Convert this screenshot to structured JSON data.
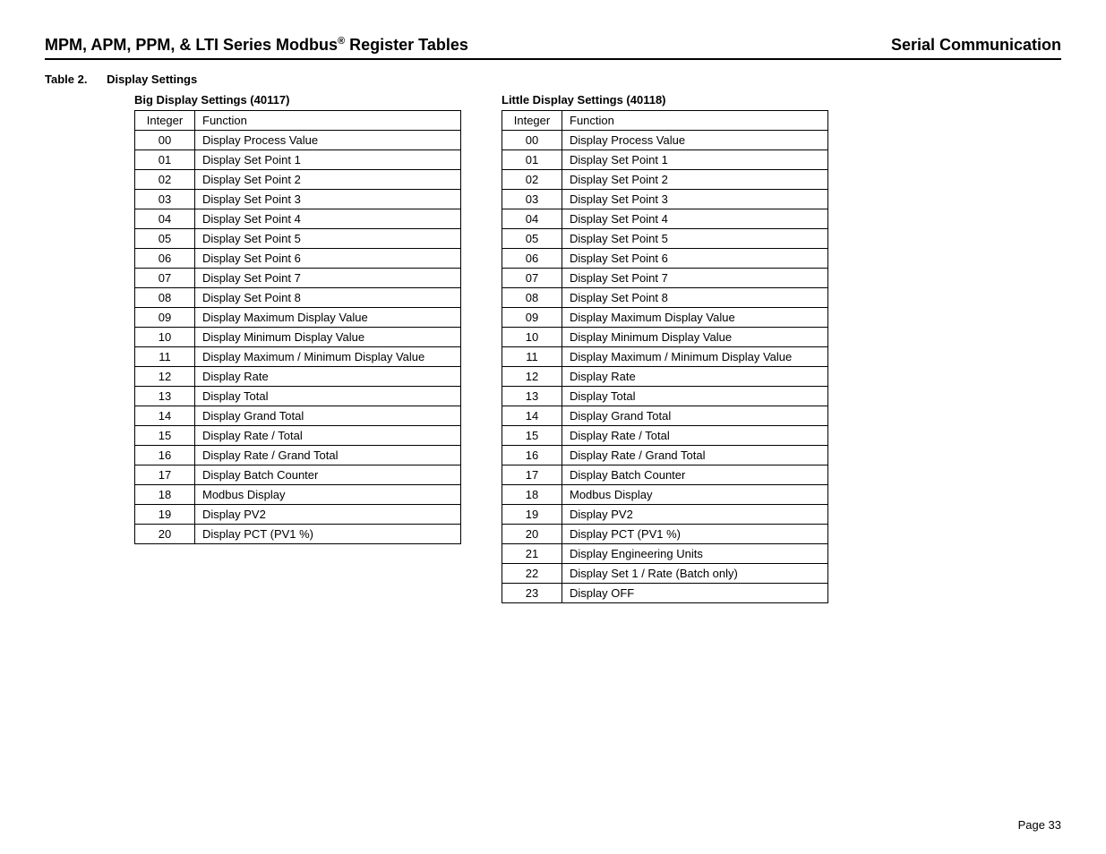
{
  "header": {
    "left_prefix": "MPM, APM, PPM, & LTI Series Modbus",
    "left_sup": "®",
    "left_suffix": " Register Tables",
    "right": "Serial Communication"
  },
  "caption": {
    "num": "Table 2.",
    "title": "Display Settings"
  },
  "tables": {
    "big": {
      "title": "Big Display Settings (40117)",
      "col1": "Integer",
      "col2": "Function",
      "rows": [
        {
          "int": "00",
          "func": "Display Process Value"
        },
        {
          "int": "01",
          "func": "Display Set Point 1"
        },
        {
          "int": "02",
          "func": "Display Set Point 2"
        },
        {
          "int": "03",
          "func": "Display Set Point 3"
        },
        {
          "int": "04",
          "func": "Display Set Point 4"
        },
        {
          "int": "05",
          "func": "Display Set Point 5"
        },
        {
          "int": "06",
          "func": "Display Set Point 6"
        },
        {
          "int": "07",
          "func": "Display Set Point 7"
        },
        {
          "int": "08",
          "func": "Display Set Point 8"
        },
        {
          "int": "09",
          "func": "Display Maximum Display Value"
        },
        {
          "int": "10",
          "func": "Display Minimum Display Value"
        },
        {
          "int": "11",
          "func": "Display Maximum / Minimum Display Value"
        },
        {
          "int": "12",
          "func": "Display Rate"
        },
        {
          "int": "13",
          "func": "Display Total"
        },
        {
          "int": "14",
          "func": "Display Grand Total"
        },
        {
          "int": "15",
          "func": "Display Rate / Total"
        },
        {
          "int": "16",
          "func": "Display Rate / Grand Total"
        },
        {
          "int": "17",
          "func": "Display Batch Counter"
        },
        {
          "int": "18",
          "func": "Modbus Display"
        },
        {
          "int": "19",
          "func": "Display PV2"
        },
        {
          "int": "20",
          "func": "Display PCT (PV1 %)"
        }
      ]
    },
    "little": {
      "title": "Little Display Settings (40118)",
      "col1": "Integer",
      "col2": "Function",
      "rows": [
        {
          "int": "00",
          "func": "Display Process Value"
        },
        {
          "int": "01",
          "func": "Display Set Point 1"
        },
        {
          "int": "02",
          "func": "Display Set Point 2"
        },
        {
          "int": "03",
          "func": "Display Set Point 3"
        },
        {
          "int": "04",
          "func": "Display Set Point 4"
        },
        {
          "int": "05",
          "func": "Display Set Point 5"
        },
        {
          "int": "06",
          "func": "Display Set Point 6"
        },
        {
          "int": "07",
          "func": "Display Set Point 7"
        },
        {
          "int": "08",
          "func": "Display Set Point 8"
        },
        {
          "int": "09",
          "func": "Display Maximum Display Value"
        },
        {
          "int": "10",
          "func": "Display Minimum Display Value"
        },
        {
          "int": "11",
          "func": "Display Maximum / Minimum Display Value"
        },
        {
          "int": "12",
          "func": "Display Rate"
        },
        {
          "int": "13",
          "func": "Display Total"
        },
        {
          "int": "14",
          "func": "Display Grand Total"
        },
        {
          "int": "15",
          "func": "Display Rate / Total"
        },
        {
          "int": "16",
          "func": "Display Rate / Grand Total"
        },
        {
          "int": "17",
          "func": "Display Batch Counter"
        },
        {
          "int": "18",
          "func": "Modbus Display"
        },
        {
          "int": "19",
          "func": "Display PV2"
        },
        {
          "int": "20",
          "func": "Display PCT (PV1 %)"
        },
        {
          "int": "21",
          "func": "Display Engineering Units"
        },
        {
          "int": "22",
          "func": "Display Set 1 / Rate (Batch only)"
        },
        {
          "int": "23",
          "func": "Display OFF"
        }
      ]
    }
  },
  "page_number": "Page 33"
}
